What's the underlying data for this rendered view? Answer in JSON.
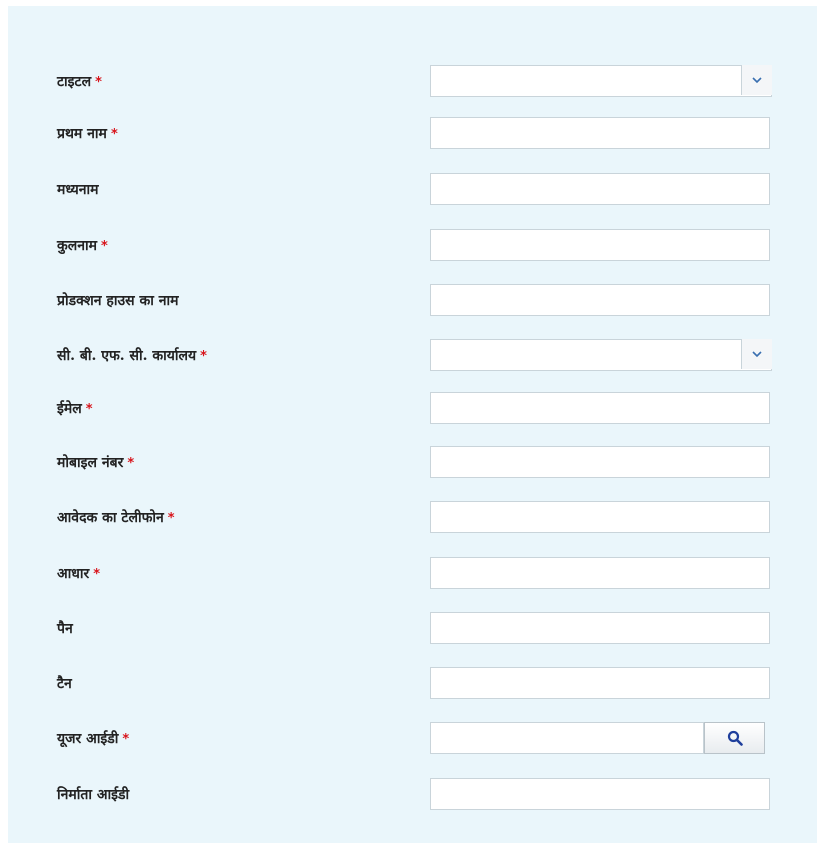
{
  "form": {
    "required_mark": "*",
    "fields": [
      {
        "label": "टाइटल",
        "required": true,
        "type": "select",
        "value": ""
      },
      {
        "label": "प्रथम नाम",
        "required": true,
        "type": "text",
        "value": ""
      },
      {
        "label": "मध्यनाम",
        "required": false,
        "type": "text",
        "value": ""
      },
      {
        "label": "कुलनाम",
        "required": true,
        "type": "text",
        "value": ""
      },
      {
        "label": "प्रोडक्शन हाउस का नाम",
        "required": false,
        "type": "text",
        "value": ""
      },
      {
        "label": "सी. बी. एफ. सी. कार्यालय",
        "required": true,
        "type": "select",
        "value": ""
      },
      {
        "label": "ईमेल",
        "required": true,
        "type": "text",
        "value": ""
      },
      {
        "label": "मोबाइल नंबर",
        "required": true,
        "type": "text",
        "value": ""
      },
      {
        "label": "आवेदक का टेलीफोन",
        "required": true,
        "type": "text",
        "value": ""
      },
      {
        "label": "आधार",
        "required": true,
        "type": "text",
        "value": ""
      },
      {
        "label": "पैन",
        "required": false,
        "type": "text",
        "value": ""
      },
      {
        "label": "टैन",
        "required": false,
        "type": "text",
        "value": ""
      },
      {
        "label": "यूजर आईडी",
        "required": true,
        "type": "search",
        "value": ""
      },
      {
        "label": "निर्माता आईडी",
        "required": false,
        "type": "text",
        "value": ""
      }
    ]
  },
  "icons": {
    "dropdown": "chevron-down-icon",
    "search": "search-icon"
  },
  "colors": {
    "panel_background": "#eaf6fb",
    "required_mark": "#d8141b",
    "search_icon": "#1f3f9c"
  }
}
